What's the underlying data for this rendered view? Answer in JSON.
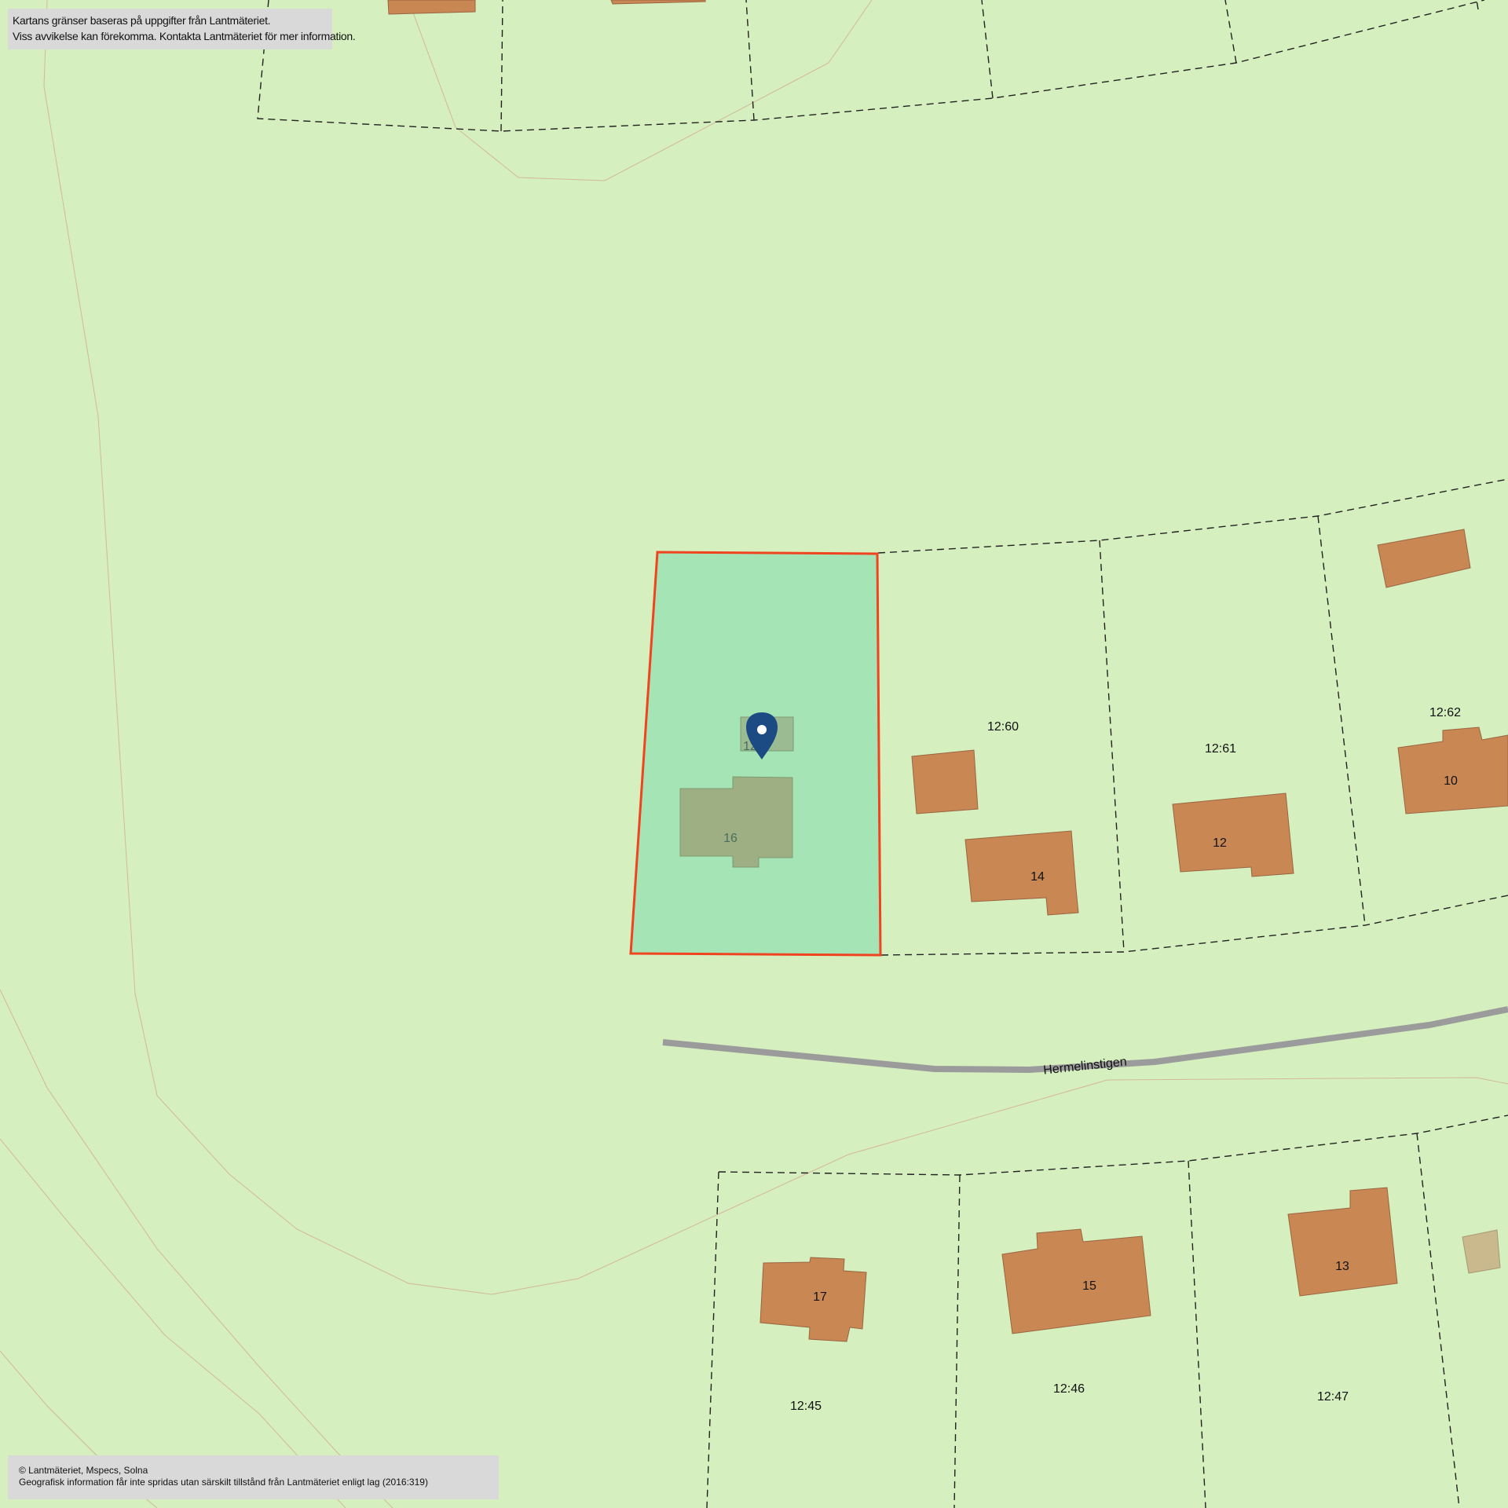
{
  "notice_top": {
    "line1": "Kartans gränser baseras på uppgifter från Lantmäteriet.",
    "line2": "Viss avvikelse kan förekomma. Kontakta Lantmäteriet för mer information."
  },
  "notice_bottom": {
    "line1": "© Lantmäteriet, Mspecs, Solna",
    "line2": "Geografisk information får inte spridas utan särskilt tillstånd från Lantmäteriet enligt lag (2016:319)"
  },
  "street": {
    "name": "Hermelinstigen"
  },
  "property_labels": {
    "p60": "12:60",
    "p61": "12:61",
    "p62": "12:62",
    "p45": "12:45",
    "p46": "12:46",
    "p47": "12:47",
    "selected_partial": "12"
  },
  "building_labels": {
    "b16": "16",
    "b14": "14",
    "b12": "12",
    "b10": "10",
    "b17": "17",
    "b15": "15",
    "b13": "13"
  },
  "colors": {
    "background": "#d5efbf",
    "building": "#c98754",
    "selected_fill": "#a5e5b5",
    "selected_border": "#f0431f",
    "road": "#9b9b9b",
    "marker": "#1c4a82"
  },
  "marker": {
    "icon": "location-pin-icon"
  }
}
